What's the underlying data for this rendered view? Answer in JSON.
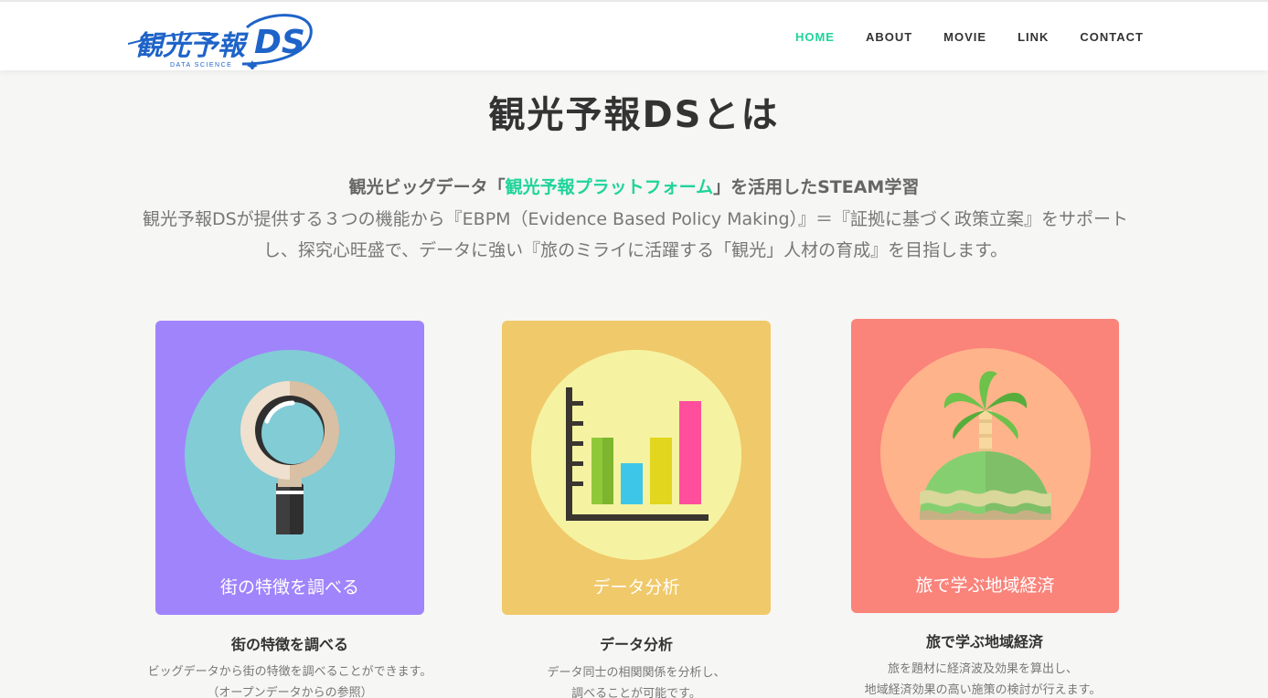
{
  "header": {
    "logo": {
      "main": "観光予報DS",
      "sub": "DATA SCIENCE"
    },
    "nav": [
      "HOME",
      "ABOUT",
      "MOVIE",
      "LINK",
      "CONTACT"
    ]
  },
  "intro": {
    "title": "観光予報DSとは",
    "lead_prefix": "観光ビッグデータ「",
    "lead_highlight": "観光予報プラットフォーム",
    "lead_suffix": "」を活用したSTEAM学習",
    "body": "観光予報DSが提供する３つの機能から『EBPM（Evidence Based Policy Making）』＝『証拠に基づく政策立案』をサポートし、探究心旺盛で、データに強い『旅のミライに活躍する「観光」人材の育成』を目指します。"
  },
  "features": [
    {
      "overlay": "街の特徴を調べる",
      "title": "街の特徴を調べる",
      "desc1": "ビッグデータから街の特徴を調べることができます。",
      "desc2": "（オープンデータからの参照）",
      "icon": "magnifier-icon",
      "card_color": "#a084fc",
      "circle_color": "#82ccd6"
    },
    {
      "overlay": "データ分析",
      "title": "データ分析",
      "desc1": "データ同士の相関関係を分析し、",
      "desc2": "調べることが可能です。",
      "icon": "bar-chart-icon",
      "card_color": "#f0c96a",
      "circle_color": "#f5f3a2"
    },
    {
      "overlay": "旅で学ぶ地域経済",
      "title": "旅で学ぶ地域経済",
      "desc1": "旅を題材に経済波及効果を算出し、",
      "desc2": "地域経済効果の高い施策の検討が行えます。",
      "icon": "palm-island-icon",
      "card_color": "#fa837a",
      "circle_color": "#ffb38a"
    }
  ],
  "colors": {
    "accent": "#1fd49a",
    "text": "#333333"
  }
}
